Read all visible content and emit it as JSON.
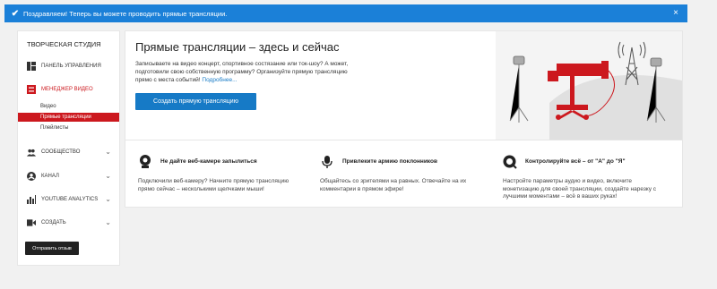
{
  "notification": {
    "message": "Поздравляем! Теперь вы можете проводить прямые трансляции.",
    "close_symbol": "×"
  },
  "sidebar": {
    "title": "ТВОРЧЕСКАЯ СТУДИЯ",
    "items": [
      {
        "label": "ПАНЕЛЬ УПРАВЛЕНИЯ",
        "icon": "dashboard-icon"
      },
      {
        "label": "МЕНЕДЖЕР ВИДЕО",
        "icon": "video-manager-icon"
      },
      {
        "label": "СООБЩЕСТВО",
        "icon": "community-icon"
      },
      {
        "label": "КАНАЛ",
        "icon": "channel-icon"
      },
      {
        "label": "YOUTUBE ANALYTICS",
        "icon": "analytics-icon"
      },
      {
        "label": "СОЗДАТЬ",
        "icon": "create-icon"
      }
    ],
    "subitems": [
      {
        "label": "Видео"
      },
      {
        "label": "Прямые трансляции"
      },
      {
        "label": "Плейлисты"
      }
    ],
    "feedback_label": "Отправить отзыв"
  },
  "hero": {
    "title": "Прямые трансляции – здесь и сейчас",
    "text": "Записываете на видео концерт, спортивное состязание или ток-шоу? А может, подготовили свою собственную программу? Организуйте прямую трансляцию прямо с места событий!",
    "more_link": "Подробнее...",
    "button_label": "Создать прямую трансляцию"
  },
  "features": [
    {
      "title": "Не дайте веб-камере запылиться",
      "text": "Подключили веб-камеру? Начните прямую трансляцию прямо сейчас – несколькими щелчками мыши!",
      "icon": "webcam-icon"
    },
    {
      "title": "Привлеките армию поклонников",
      "text": "Общайтесь со зрителями на равных. Отвечайте на их комментарии в прямом эфире!",
      "icon": "microphone-icon"
    },
    {
      "title": "Контролируйте всё – от \"А\" до \"Я\"",
      "text": "Настройте параметры аудио и видео, включите монетизацию для своей трансляции, создайте нарезку с лучшими моментами – всё в ваших руках!",
      "icon": "control-icon"
    }
  ],
  "colors": {
    "accent_blue": "#167ac6",
    "notification_blue": "#1b80d8",
    "brand_red": "#cc181e"
  }
}
